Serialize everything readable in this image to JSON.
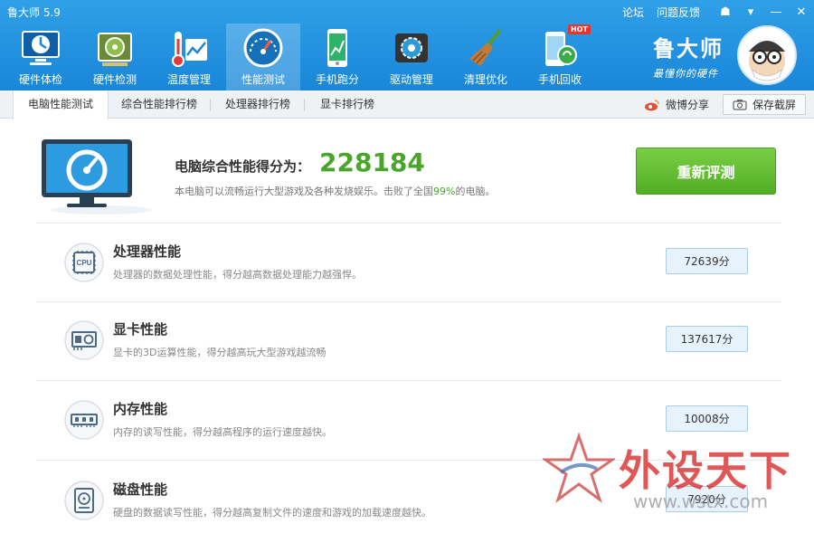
{
  "app": {
    "title": "鲁大师 5.9"
  },
  "top_links": {
    "forum": "论坛",
    "feedback": "问题反馈"
  },
  "window_controls": {
    "skin": "☗",
    "menu": "▾",
    "minimize": "—",
    "close": "✕"
  },
  "nav": {
    "items": [
      {
        "label": "硬件体检",
        "icon": "clock-monitor-icon"
      },
      {
        "label": "硬件检测",
        "icon": "graphics-card-icon"
      },
      {
        "label": "温度管理",
        "icon": "thermometer-icon"
      },
      {
        "label": "性能测试",
        "icon": "speedometer-icon"
      },
      {
        "label": "手机跑分",
        "icon": "phone-chart-icon"
      },
      {
        "label": "驱动管理",
        "icon": "gear-box-icon"
      },
      {
        "label": "清理优化",
        "icon": "broom-icon"
      },
      {
        "label": "手机回收",
        "icon": "phone-recycle-icon"
      }
    ],
    "active_index": 3,
    "hot_badge": "HOT"
  },
  "brand": {
    "name": "鲁大师",
    "slogan": "最懂你的硬件"
  },
  "tabs": [
    {
      "label": "电脑性能测试"
    },
    {
      "label": "综合性能排行榜"
    },
    {
      "label": "处理器排行榜"
    },
    {
      "label": "显卡排行榜"
    }
  ],
  "toolbar": {
    "share_label": "微博分享",
    "screenshot_label": "保存截屏"
  },
  "summary": {
    "label": "电脑综合性能得分为：",
    "score": "228184",
    "desc_pre": "本电脑可以流畅运行大型游戏及各种发烧娱乐。击败了全国",
    "desc_pct": "99%",
    "desc_post": "的电脑。",
    "retest_label": "重新评测"
  },
  "items": [
    {
      "title": "处理器性能",
      "desc": "处理器的数据处理性能，得分越高数据处理能力越强悍。",
      "score": "72639分",
      "icon": "cpu-icon",
      "icon_text": "CPU"
    },
    {
      "title": "显卡性能",
      "desc": "显卡的3D运算性能，得分越高玩大型游戏越流畅",
      "score": "137617分",
      "icon": "graphics-card-icon"
    },
    {
      "title": "内存性能",
      "desc": "内存的读写性能，得分越高程序的运行速度越快。",
      "score": "10008分",
      "icon": "memory-icon"
    },
    {
      "title": "磁盘性能",
      "desc": "硬盘的数据读写性能，得分越高复制文件的速度和游戏的加载速度越快。",
      "score": "7920分",
      "icon": "disk-icon"
    }
  ],
  "watermark": {
    "text": "外设天下",
    "url": "www.wstx.com"
  },
  "colors": {
    "header_blue": "#1a86d8",
    "score_green": "#4aa62a",
    "button_green": "#52ae26",
    "score_box_bg": "#e6f2fc"
  }
}
